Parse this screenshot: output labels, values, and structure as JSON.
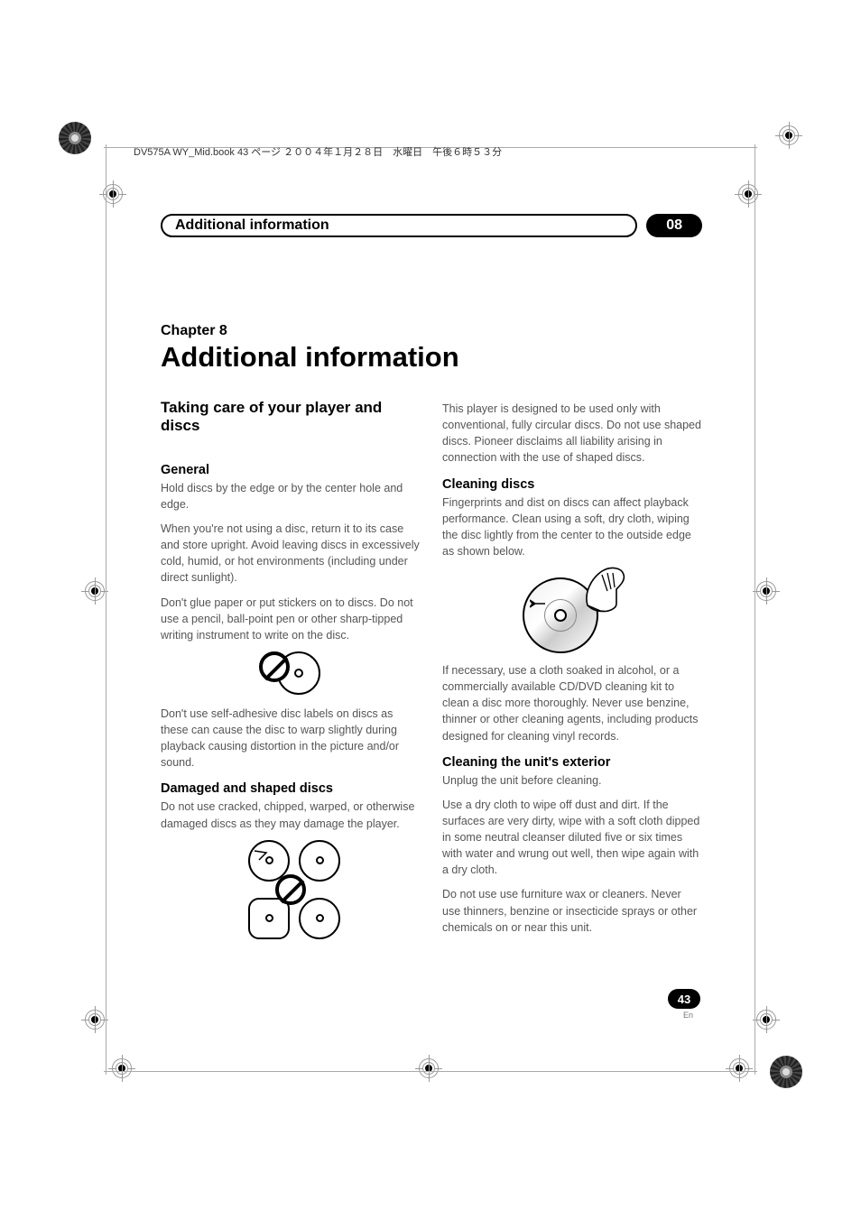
{
  "header_line": "DV575A WY_Mid.book  43 ページ  ２００４年１月２８日　水曜日　午後６時５３分",
  "section_header": {
    "title": "Additional information",
    "number": "08"
  },
  "chapter_label": "Chapter 8",
  "page_title": "Additional information",
  "left": {
    "h2": "Taking care of your player and discs",
    "general_h": "General",
    "general_p1": "Hold discs by the edge or by the center hole and edge.",
    "general_p2": "When you're not using a disc, return it to its case and store upright. Avoid leaving discs in excessively cold, humid, or hot environments (including under direct sunlight).",
    "general_p3": "Don't glue paper or put stickers on to discs. Do not use a pencil, ball-point pen or other sharp-tipped writing instrument to write on the disc.",
    "general_p4": "Don't use self-adhesive disc labels on discs as these can cause the disc to warp slightly during playback causing distortion in the picture and/or sound.",
    "damaged_h": "Damaged and shaped discs",
    "damaged_p1": "Do not use cracked, chipped, warped, or otherwise damaged discs as they may damage the player."
  },
  "right": {
    "shaped_p1": "This player is designed to be used only with conventional, fully circular discs. Do not use shaped discs. Pioneer disclaims all liability arising in connection with the use of shaped discs.",
    "clean_h": "Cleaning discs",
    "clean_p1": "Fingerprints and dist on discs can affect playback performance. Clean using a soft, dry cloth, wiping the disc lightly from the center to the outside edge as shown below.",
    "clean_p2": "If necessary, use a cloth soaked in alcohol, or a commercially available CD/DVD cleaning kit to clean a disc more thoroughly. Never use benzine, thinner or other cleaning agents, including products designed for cleaning vinyl records.",
    "ext_h": "Cleaning the unit's exterior",
    "ext_p1": "Unplug the unit before cleaning.",
    "ext_p2": "Use a dry cloth to wipe off dust and dirt. If the surfaces are very dirty, wipe with a soft cloth dipped in some neutral cleanser diluted five or six times with water and wrung out well, then wipe again with a dry cloth.",
    "ext_p3": "Do not use use furniture wax or cleaners. Never use thinners, benzine or insecticide sprays or other chemicals on or near this unit."
  },
  "page_number": "43",
  "page_lang": "En"
}
